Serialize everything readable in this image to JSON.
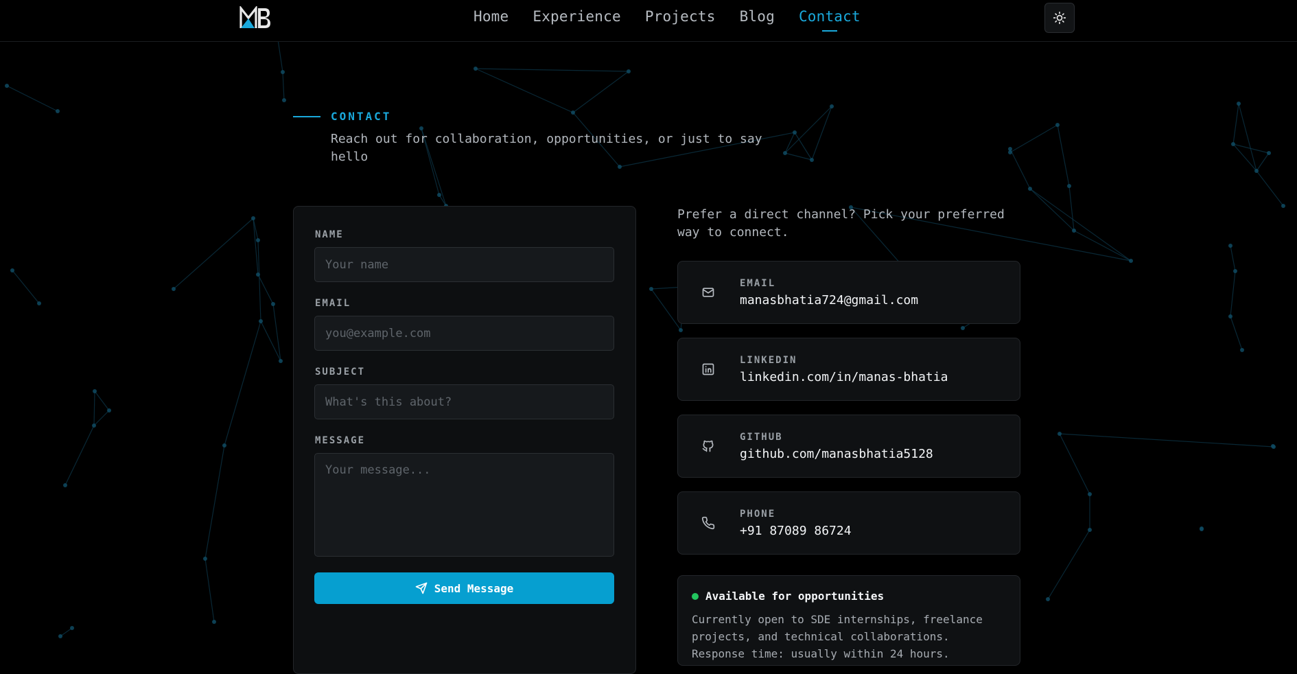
{
  "nav": {
    "logo_text": "MB",
    "items": [
      {
        "label": "Home",
        "active": false
      },
      {
        "label": "Experience",
        "active": false
      },
      {
        "label": "Projects",
        "active": false
      },
      {
        "label": "Blog",
        "active": false
      },
      {
        "label": "Contact",
        "active": true
      }
    ],
    "theme_toggle_icon": "sun-icon"
  },
  "section": {
    "label": "CONTACT",
    "subtitle": "Reach out for collaboration, opportunities, or just to say hello"
  },
  "form": {
    "name_label": "NAME",
    "name_placeholder": "Your name",
    "email_label": "EMAIL",
    "email_placeholder": "you@example.com",
    "subject_label": "SUBJECT",
    "subject_placeholder": "What's this about?",
    "message_label": "MESSAGE",
    "message_placeholder": "Your message...",
    "submit_label": "Send Message",
    "submit_icon": "send-icon"
  },
  "channels": {
    "intro": "Prefer a direct channel? Pick your preferred way to connect.",
    "items": [
      {
        "label": "EMAIL",
        "value": "manasbhatia724@gmail.com",
        "icon": "mail-icon"
      },
      {
        "label": "LINKEDIN",
        "value": "linkedin.com/in/manas-bhatia",
        "icon": "linkedin-icon"
      },
      {
        "label": "GITHUB",
        "value": "github.com/manasbhatia5128",
        "icon": "github-icon"
      },
      {
        "label": "PHONE",
        "value": "+91 87089 86724",
        "icon": "phone-icon"
      }
    ]
  },
  "availability": {
    "title": "Available for opportunities",
    "text": "Currently open to SDE internships, freelance projects, and technical collaborations. Response time: usually within 24 hours."
  },
  "colors": {
    "accent": "#1aa9dc",
    "button": "#069fd0",
    "status_online": "#22c55e",
    "background": "#000000"
  }
}
